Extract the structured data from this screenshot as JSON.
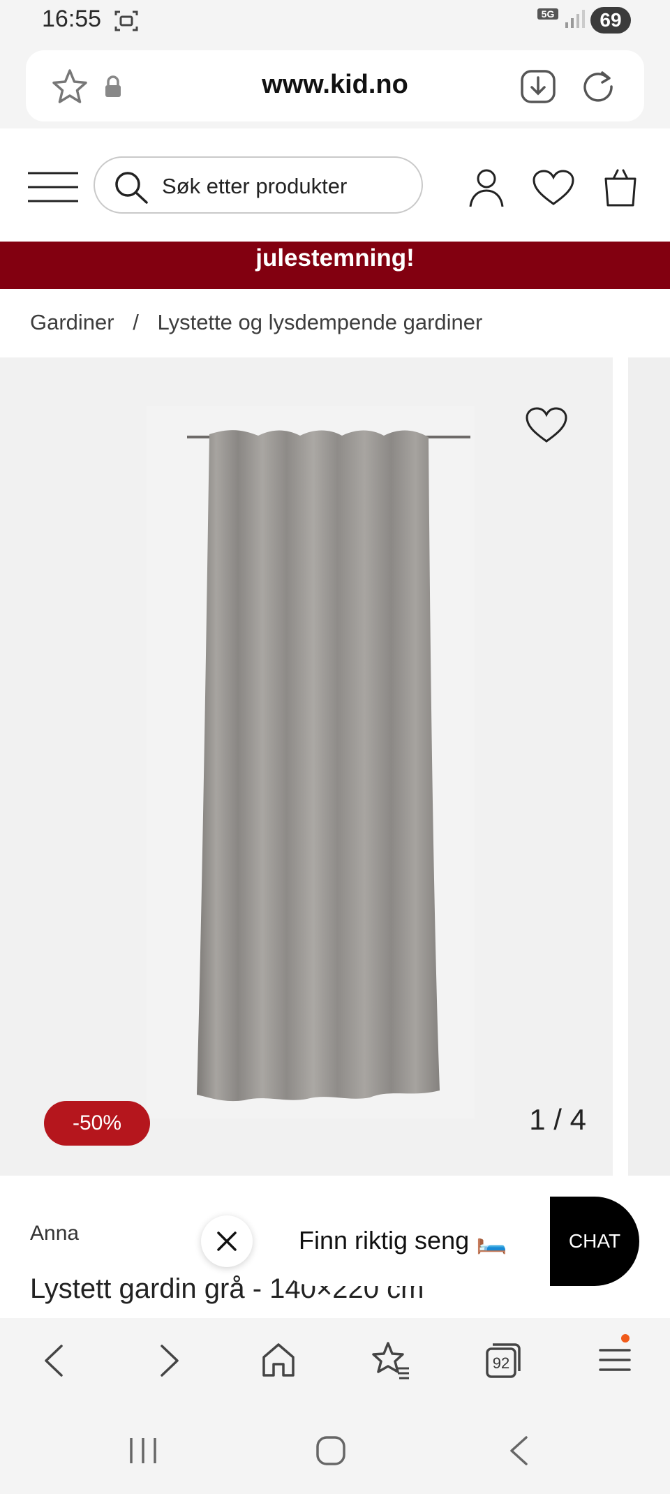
{
  "status_bar": {
    "time": "16:55",
    "network": "5G",
    "battery": "69"
  },
  "url_bar": {
    "url": "www.kid.no"
  },
  "header": {
    "search_placeholder": "Søk etter produkter"
  },
  "promo": {
    "text": "julestemning!"
  },
  "breadcrumb": {
    "items": [
      "Gardiner",
      "Lystette og lysdempende gardiner"
    ],
    "separator": "/"
  },
  "gallery": {
    "discount": "-50%",
    "counter": "1 / 4"
  },
  "product": {
    "brand": "Anna",
    "title": "Lystett gardin grå - 140×220 cm"
  },
  "chat": {
    "prompt": "Finn riktig seng 🛏️",
    "button": "CHAT"
  },
  "browser_nav": {
    "tab_count": "92"
  },
  "colors": {
    "promo_bg": "#820010",
    "discount_bg": "#b5161d",
    "chat_button_bg": "#000000"
  }
}
